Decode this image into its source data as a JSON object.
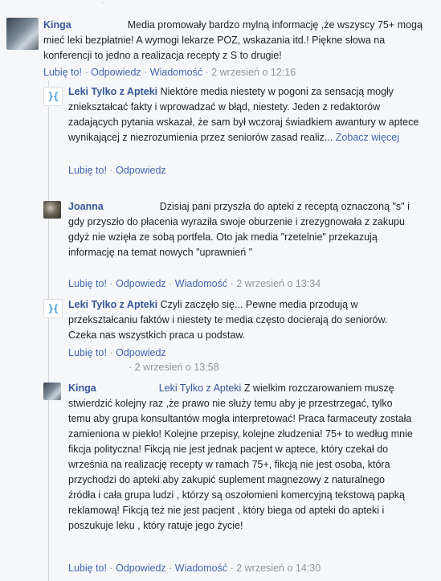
{
  "top": {
    "dot": "·"
  },
  "comments": [
    {
      "author": "Kinga",
      "text": "Media promowały bardzo mylną informację ,że wszyscy 75+ mogą mieć leki bezpłatnie! A wymogi lekarze POZ, wskazania itd.! Piękne słowa na konferencji to jedno a realizacja recepty z S to drugie!",
      "like": "Lubię to!",
      "reply": "Odpowiedz",
      "message": "Wiadomość",
      "time": "2 wrzesień o 12:16",
      "sep": "·"
    },
    {
      "author": "Leki Tylko z Apteki",
      "text": "Niektóre media niestety w pogoni za sensacją mogły zniekształcać fakty i wprowadzać w błąd, niestety. Jeden z redaktorów zadających pytania wskazał, że sam był wczoraj świadkiem awantury w aptece wynikającej z niezrozumienia przez seniorów zasad realiz...",
      "see_more": "Zobacz więcej",
      "like": "Lubię to!",
      "reply": "Odpowiedz",
      "sep": "·"
    },
    {
      "author": "Joanna",
      "text": "Dzisiaj pani przyszła do apteki z receptą oznaczoną \"s\" i gdy przyszło do płacenia wyraziła swoje oburzenie i zrezygnowała z zakupu gdyż nie wzięła ze sobą portfela. Oto jak media \"rzetelnie\" przekazują informację na temat nowych \"uprawnień \"",
      "like": "Lubię to!",
      "reply": "Odpowiedz",
      "message": "Wiadomość",
      "time": "2 wrzesień o 13:34",
      "sep": "·"
    },
    {
      "author": "Leki Tylko z Apteki",
      "text": "Czyli zaczęło się... Pewne media przodują w przekształcaniu faktów i niestety te media często docierają do seniorów. Czeka nas wszystkich praca u podstaw.",
      "like": "Lubię to!",
      "reply": "Odpowiedz",
      "time": "2 wrzesień o 13:58",
      "sep": "·"
    },
    {
      "author": "Kinga",
      "mention": "Leki Tylko z Apteki",
      "text": "Z wielkim rozczarowaniem muszę stwierdzić kolejny raz ,że prawo nie służy temu aby je przestrzegać, tylko temu aby grupa konsultantów mogła interpretować! Praca farmaceuty została zamieniona w piekło! Kolejne przepisy, kolejne złudzenia! 75+ to według mnie fikcja polityczna! Fikcją nie jest jednak pacjent w aptece, który czekał do września na realizację recepty w ramach 75+, fikcją nie jest osoba, która przychodzi do apteki aby zakupić suplement magnezowy z naturalnego źródła i cała grupa ludzi , którzy są oszołomieni komercyjną tekstową papką reklamową! Fikcją też nie jest pacjent , który biega od apteki do apteki i poszukuje leku , który ratuje jego życie!",
      "like": "Lubię to!",
      "reply": "Odpowiedz",
      "message": "Wiadomość",
      "time": "2 wrzesień o 14:30",
      "sep": "·"
    }
  ],
  "logo_glyph": "}{",
  "colors": {
    "link": "#365899",
    "action": "#4267b2",
    "muted": "#90949c",
    "background": "#f6f7f9"
  }
}
